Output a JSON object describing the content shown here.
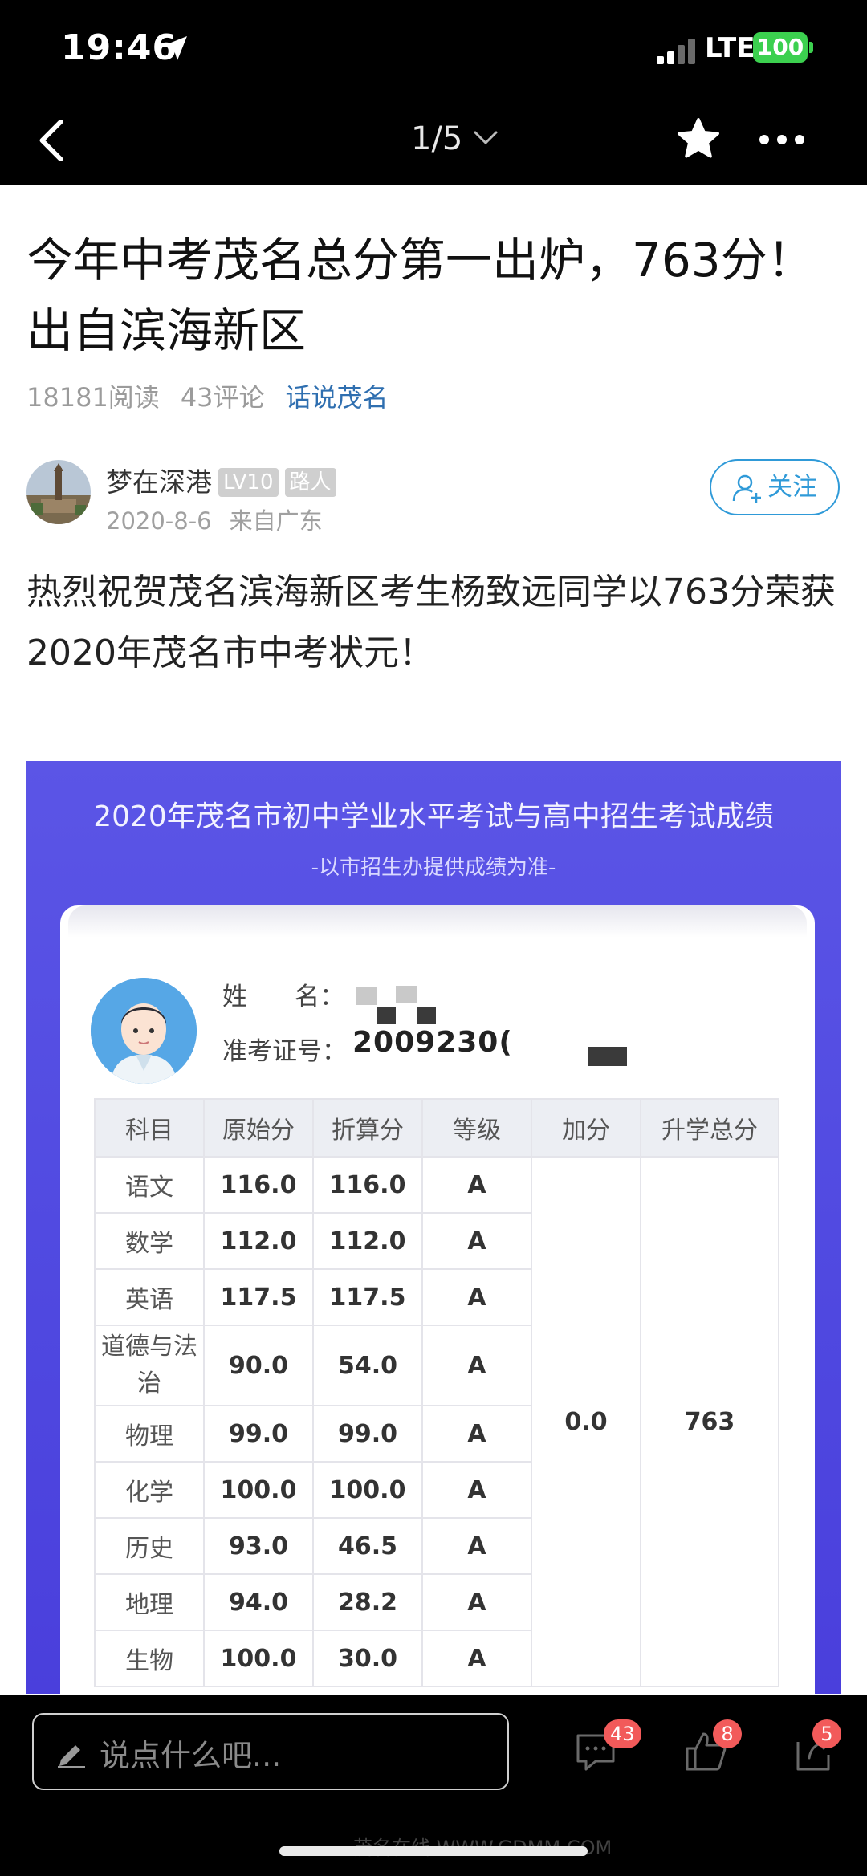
{
  "status_bar": {
    "time": "19:46",
    "network": "LTE",
    "battery": "100"
  },
  "nav": {
    "pager": "1/5"
  },
  "article": {
    "title": "今年中考茂名总分第一出炉，763分！出自滨海新区",
    "reads": "18181阅读",
    "comments": "43评论",
    "topic": "话说茂名",
    "author": {
      "name": "梦在深港",
      "level": "LV10",
      "role": "路人",
      "date": "2020-8-6",
      "from": "来自广东"
    },
    "follow_label": "关注",
    "body": "热烈祝贺茂名滨海新区考生杨致远同学以763分荣获2020年茂名市中考状元！"
  },
  "score_image": {
    "title": "2020年茂名市初中学业水平考试与高中招生考试成绩",
    "subtitle": "-以市招生办提供成绩为准-",
    "name_label": "姓      名：",
    "id_label": "准考证号：",
    "id_value": "2009230(",
    "headers": [
      "科目",
      "原始分",
      "折算分",
      "等级",
      "加分",
      "升学总分"
    ],
    "rows": [
      {
        "subject": "语文",
        "raw": "116.0",
        "converted": "116.0",
        "grade": "A"
      },
      {
        "subject": "数学",
        "raw": "112.0",
        "converted": "112.0",
        "grade": "A"
      },
      {
        "subject": "英语",
        "raw": "117.5",
        "converted": "117.5",
        "grade": "A"
      },
      {
        "subject": "道德与法治",
        "raw": "90.0",
        "converted": "54.0",
        "grade": "A"
      },
      {
        "subject": "物理",
        "raw": "99.0",
        "converted": "99.0",
        "grade": "A"
      },
      {
        "subject": "化学",
        "raw": "100.0",
        "converted": "100.0",
        "grade": "A"
      },
      {
        "subject": "历史",
        "raw": "93.0",
        "converted": "46.5",
        "grade": "A"
      },
      {
        "subject": "地理",
        "raw": "94.0",
        "converted": "28.2",
        "grade": "A"
      },
      {
        "subject": "生物",
        "raw": "100.0",
        "converted": "30.0",
        "grade": "A"
      }
    ],
    "bonus": "0.0",
    "total": "763"
  },
  "bottom_bar": {
    "placeholder": "说点什么吧...",
    "comment_count": "43",
    "like_count": "8",
    "share_count": "5"
  },
  "watermark": "茂名在线 WWW.GDMM.COM",
  "colors": {
    "accent_blue": "#2f9ad8",
    "topic_blue": "#2f6fb0",
    "badge_red": "#f25a5a",
    "score_bg": "#5249e2"
  }
}
